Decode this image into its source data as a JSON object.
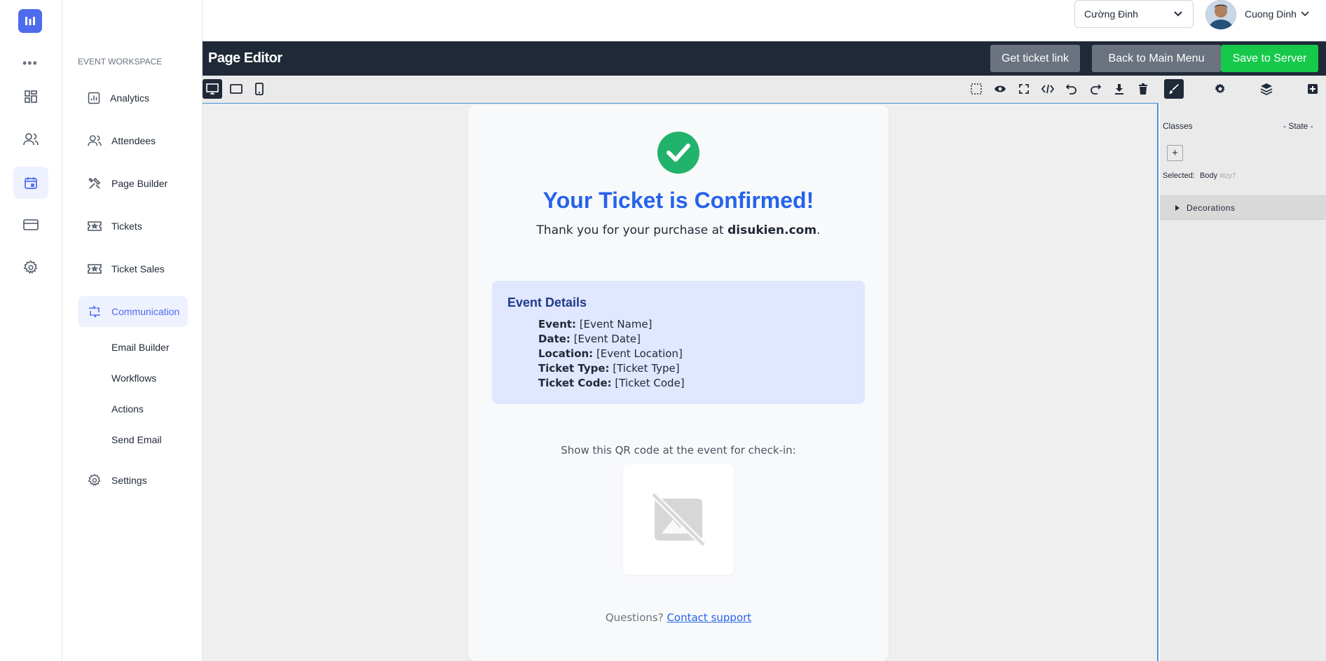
{
  "topbar": {
    "org_select": "Cường Đinh",
    "user_name": "Cuong Dinh"
  },
  "nav": {
    "section_title": "EVENT WORKSPACE",
    "items": [
      {
        "label": "Analytics"
      },
      {
        "label": "Attendees"
      },
      {
        "label": "Page Builder"
      },
      {
        "label": "Tickets"
      },
      {
        "label": "Ticket Sales"
      },
      {
        "label": "Communication"
      },
      {
        "label": "Settings"
      }
    ],
    "sub_items": [
      {
        "label": "Email Builder"
      },
      {
        "label": "Workflows"
      },
      {
        "label": "Actions"
      },
      {
        "label": "Send Email"
      }
    ]
  },
  "editor": {
    "title": "Page Editor",
    "get_ticket_link": "Get ticket link",
    "back_to_main": "Back to Main Menu",
    "save": "Save to Server"
  },
  "page": {
    "heading": "Your Ticket is Confirmed!",
    "thanks_prefix": "Thank you for your purchase at ",
    "thanks_site": "disukien.com",
    "thanks_suffix": ".",
    "details_title": "Event Details",
    "details": [
      {
        "key": "Event:",
        "value": " [Event Name]"
      },
      {
        "key": "Date:",
        "value": " [Event Date]"
      },
      {
        "key": "Location:",
        "value": " [Event Location]"
      },
      {
        "key": "Ticket Type:",
        "value": " [Ticket Type]"
      },
      {
        "key": "Ticket Code:",
        "value": " [Ticket Code]"
      }
    ],
    "qr_label": "Show this QR code at the event for check-in:",
    "questions": "Questions? ",
    "support_link": "Contact support"
  },
  "panel": {
    "classes": "Classes",
    "state": "- State -",
    "selected_label": "Selected:",
    "selected_value": "Body",
    "selected_id": "#izy7",
    "decorations": "Decorations"
  },
  "colors": {
    "accent": "#4f6bed",
    "heading_blue": "#2563eb",
    "save_green": "#16c94a",
    "editor_dark": "#1f2937",
    "success": "#21b26b"
  }
}
